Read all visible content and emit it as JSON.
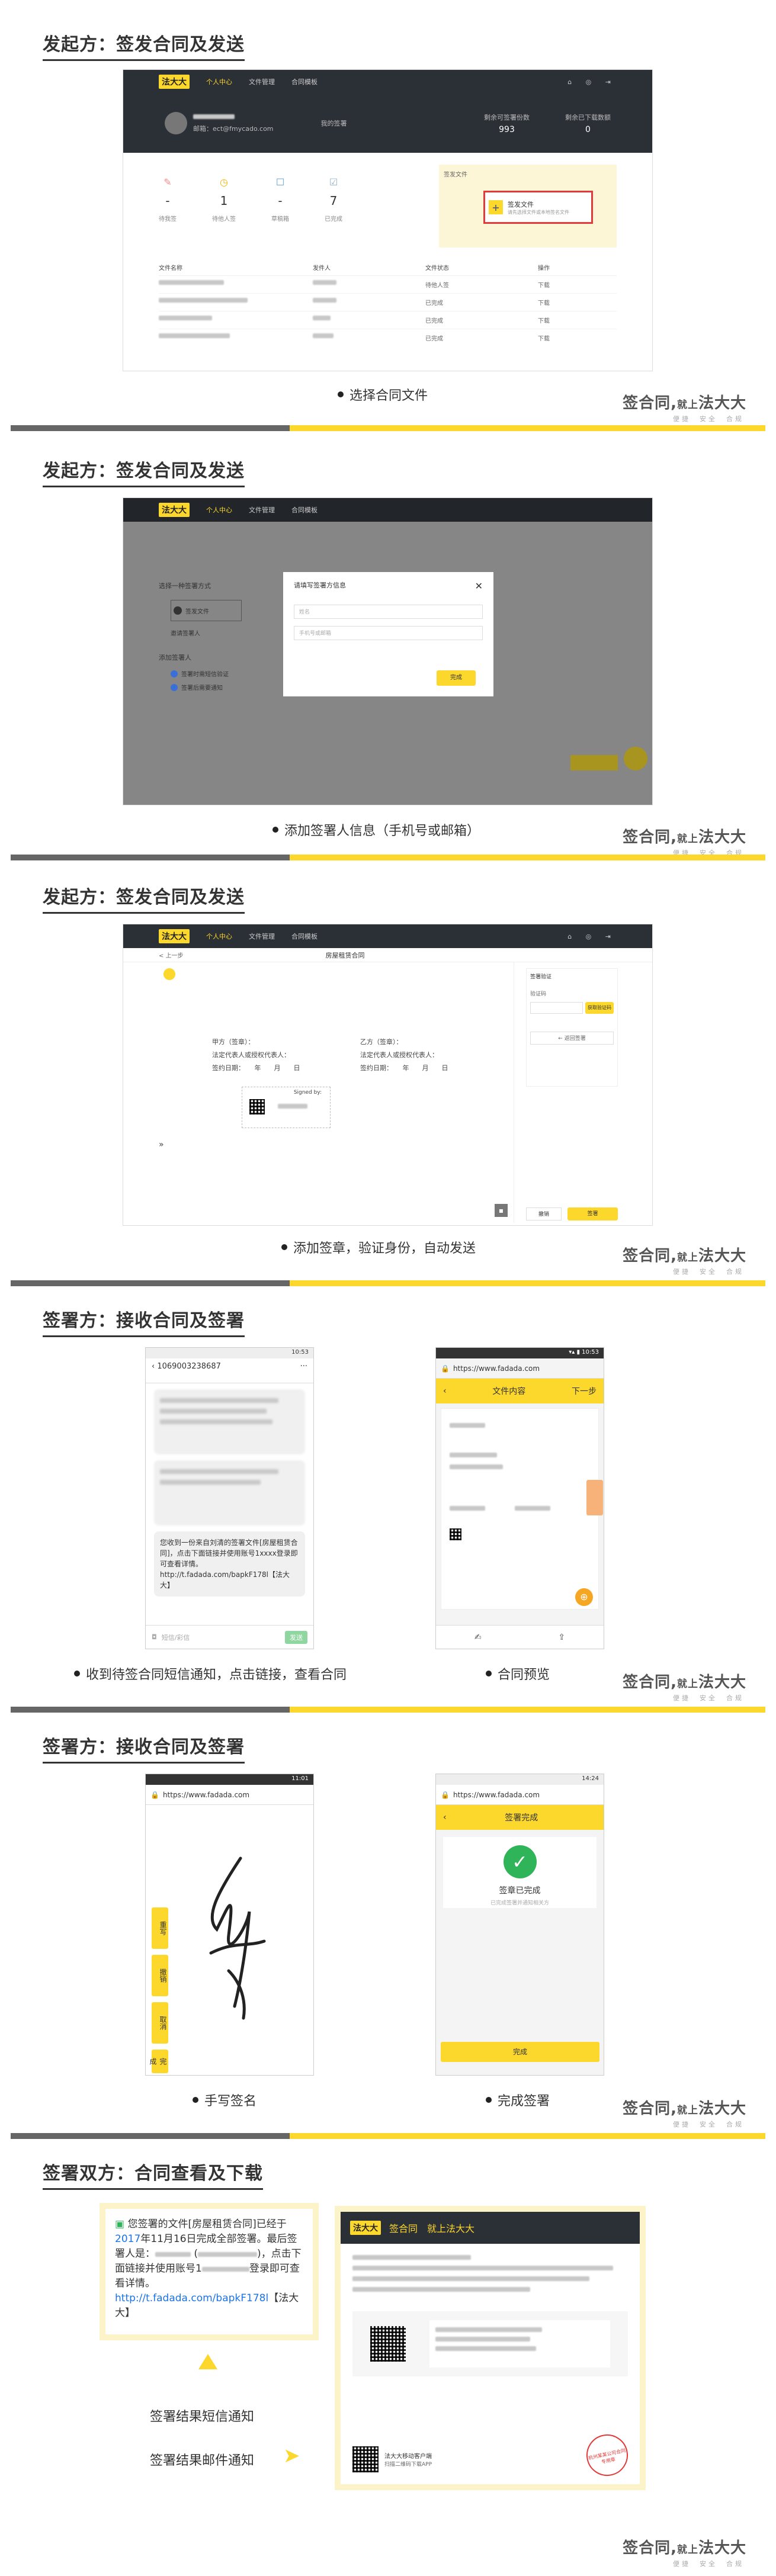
{
  "sections": [
    {
      "title": "发起方：签发合同及发送",
      "caption": "选择合同文件"
    },
    {
      "title": "发起方：签发合同及发送",
      "caption": "添加签署人信息（手机号或邮箱）"
    },
    {
      "title": "发起方：签发合同及发送",
      "caption": "添加签章，验证身份，自动发送"
    },
    {
      "title": "签署方：接收合同及签署",
      "caption1": "收到待签合同短信通知，点击链接，查看合同",
      "caption2": "合同预览"
    },
    {
      "title": "签署方：接收合同及签署",
      "caption1": "手写签名",
      "caption2": "完成签署"
    },
    {
      "title": "签署双方：合同查看及下载",
      "caption1": "签署结果短信通知",
      "caption2": "签署结果邮件通知"
    }
  ],
  "brand": {
    "main": "签合同,",
    "small": "就上",
    "tail": "法大大",
    "sub": "便捷　安全　合规"
  },
  "app": {
    "logo": "法大大",
    "nav_personal": "个人中心",
    "nav_files": "文件管理",
    "nav_templates": "合同模板",
    "email": "邮箱：ect@fmycado.com",
    "sign_count_label": "我的签署",
    "stat1_label": "剩余可签署份数",
    "stat1_value": "993",
    "stat2_label": "剩余已下载数额",
    "stat2_value": "0",
    "counters": [
      {
        "value": "-",
        "label": "待我签"
      },
      {
        "value": "1",
        "label": "待他人签"
      },
      {
        "value": "-",
        "label": "草稿箱"
      },
      {
        "value": "7",
        "label": "已完成"
      }
    ],
    "upload_title": "签发文件",
    "upload_btn": "签发文件",
    "upload_desc": "请先选择文件或本地签名文件",
    "table_headers": [
      "文件名称",
      "发件人",
      "文件状态",
      "操作"
    ],
    "row_status": [
      "待他人签",
      "已完成",
      "已完成",
      "已完成"
    ],
    "row_action": "下载",
    "modal_title": "请填写签署方信息",
    "modal_field1": "姓名",
    "modal_field2": "手机号或邮箱",
    "modal_btn": "完成",
    "dialog_heading": "选择一种签署方式",
    "dialog_opt": "签发文件",
    "dialog_sub": "邀请签署人",
    "dialog_add": "添加签署人",
    "dialog_check1": "签署时需短信验证",
    "dialog_check2": "签署后需要通知",
    "doc_back": "< 上一步",
    "doc_title": "房屋租赁合同",
    "party_a": "甲方（签章）：",
    "party_b": "乙方（签章）：",
    "legal_a": "法定代表人或授权代表人：",
    "date_label": "签约日期：　　年　　月　　日",
    "signed_by": "Signed by:",
    "sign_panel_title": "签署验证",
    "sign_panel_code": "验证码",
    "sign_panel_get": "获取验证码",
    "sign_panel_back": "← 返回签署",
    "btn_cancel": "撤销",
    "btn_sign": "签署"
  },
  "phones": {
    "sms_number": "1069003238687",
    "sms_notice": "您收到一份来自刘清的签署文件[房屋租赁合同]，点击下面链接并使用账号1xxxx登录即可查看详情。http://t.fadada.com/bapkF178l【法大大】",
    "sms_input": "短信/彩信",
    "sms_send": "发送",
    "time1": "10:53",
    "url": "https://www.fadada.com",
    "doc_header": "文件内容",
    "doc_next": "下一步",
    "time2": "14:24",
    "sign_done_header": "签署完成",
    "sign_done_title": "签章已完成",
    "sign_done_sub": "已完成签署并通知相关方",
    "sign_done_btn": "完成",
    "sig_buttons": [
      "重写",
      "撤销",
      "取消",
      "完成"
    ],
    "time3": "11:01"
  },
  "result": {
    "sms_text_a": "您签署的文件[房屋租赁合同]已经于",
    "sms_year": "2017",
    "sms_text_b": "年11月16日完成全部签署。最后签署人是：",
    "sms_text_c": "，点击下面链接并使用账号1",
    "sms_text_d": "登录即可查看详情。",
    "sms_link": "http://t.fadada.com/bapkF178l",
    "sms_tag": "【法大大】",
    "mail_slogan": "签合同　就上法大大",
    "mail_logo": "法大大",
    "mail_app": "法大大移动客户端",
    "mail_qr_label": "扫描二维码下载APP",
    "stamp": "杭州某某公司合同专用章"
  },
  "colors": {
    "accent": "#fcd72c",
    "dark": "#2b2f36",
    "red": "#e23a3a",
    "green": "#2fb45a"
  }
}
